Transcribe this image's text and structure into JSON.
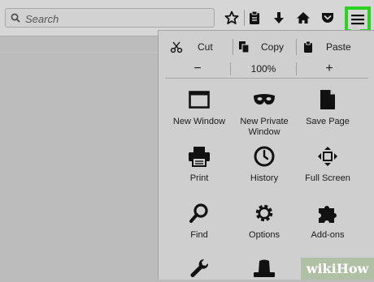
{
  "toolbar": {
    "search_placeholder": "Search",
    "icons": [
      "search-icon",
      "star-icon",
      "reading-list-icon",
      "download-icon",
      "home-icon",
      "pocket-icon",
      "hamburger-menu-icon"
    ]
  },
  "panel": {
    "edit": {
      "cut": "Cut",
      "copy": "Copy",
      "paste": "Paste"
    },
    "zoom": {
      "minus": "−",
      "level": "100%",
      "plus": "+"
    },
    "items": [
      {
        "name": "new-window",
        "label": "New Window",
        "icon": "window-icon"
      },
      {
        "name": "new-private-window",
        "label": "New Private Window",
        "icon": "mask-icon"
      },
      {
        "name": "save-page",
        "label": "Save Page",
        "icon": "page-icon"
      },
      {
        "name": "print",
        "label": "Print",
        "icon": "printer-icon"
      },
      {
        "name": "history",
        "label": "History",
        "icon": "clock-icon"
      },
      {
        "name": "full-screen",
        "label": "Full Screen",
        "icon": "fullscreen-icon"
      },
      {
        "name": "find",
        "label": "Find",
        "icon": "magnifier-icon"
      },
      {
        "name": "options",
        "label": "Options",
        "icon": "gear-icon"
      },
      {
        "name": "add-ons",
        "label": "Add-ons",
        "icon": "puzzle-icon"
      },
      {
        "name": "developer",
        "label": "",
        "icon": "wrench-icon"
      },
      {
        "name": "customize",
        "label": "",
        "icon": "hat-icon"
      }
    ]
  },
  "watermark": {
    "text": "wikiHow"
  },
  "colors": {
    "highlight": "#2bd21f",
    "panel": "#cfcfcf",
    "toolbar": "#d6d6d6"
  }
}
